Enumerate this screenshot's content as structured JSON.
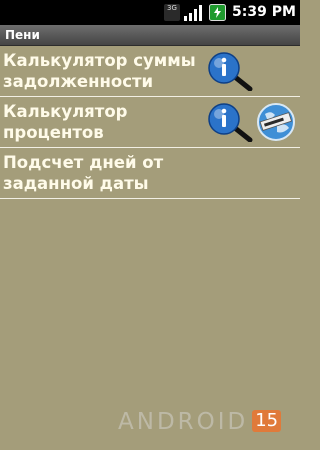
{
  "status_bar": {
    "network_type": "3G",
    "signal_icon": "signal-bars-icon",
    "battery_icon": "battery-charging-icon",
    "time": "5:39 PM"
  },
  "app": {
    "title": "Пени"
  },
  "menu": {
    "items": [
      {
        "label": "Калькулятор суммы задолженности",
        "info_icon": "info-magnifier-icon"
      },
      {
        "label": "Калькулятор процентов",
        "info_icon": "info-magnifier-icon",
        "extra_icon": "globe-www-icon"
      },
      {
        "label": "Подсчет дней от заданной даты"
      }
    ]
  },
  "watermark": {
    "text": "ANDROID",
    "badge": "15"
  },
  "colors": {
    "background": "#a49d7a",
    "title_bar": "#555555",
    "item_text": "#fffbe9",
    "divider": "#f2efe4"
  }
}
